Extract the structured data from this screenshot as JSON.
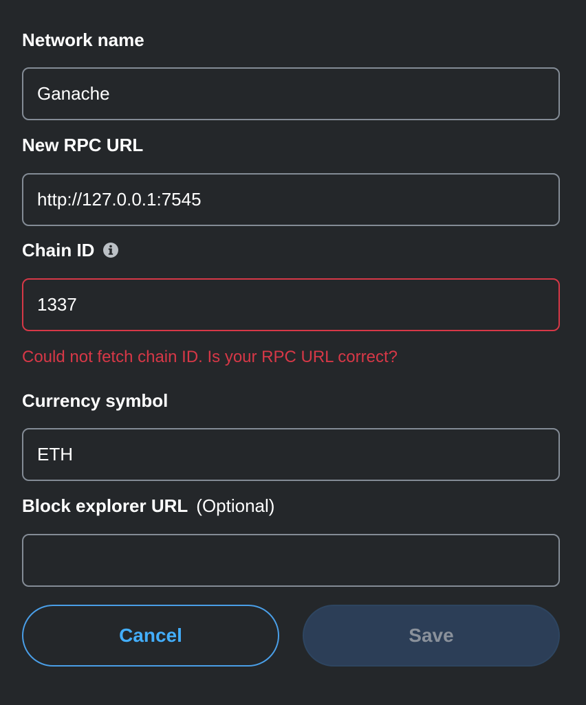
{
  "form": {
    "network_name": {
      "label": "Network name",
      "value": "Ganache"
    },
    "rpc_url": {
      "label": "New RPC URL",
      "value": "http://127.0.0.1:7545"
    },
    "chain_id": {
      "label": "Chain ID",
      "value": "1337",
      "error": "Could not fetch chain ID. Is your RPC URL correct?",
      "info_icon": "info-icon"
    },
    "currency_symbol": {
      "label": "Currency symbol",
      "value": "ETH"
    },
    "block_explorer": {
      "label": "Block explorer URL",
      "optional": "(Optional)",
      "value": ""
    }
  },
  "actions": {
    "cancel_label": "Cancel",
    "save_label": "Save"
  },
  "colors": {
    "background": "#24272a",
    "error": "#d73847",
    "accent": "#43aefc"
  }
}
